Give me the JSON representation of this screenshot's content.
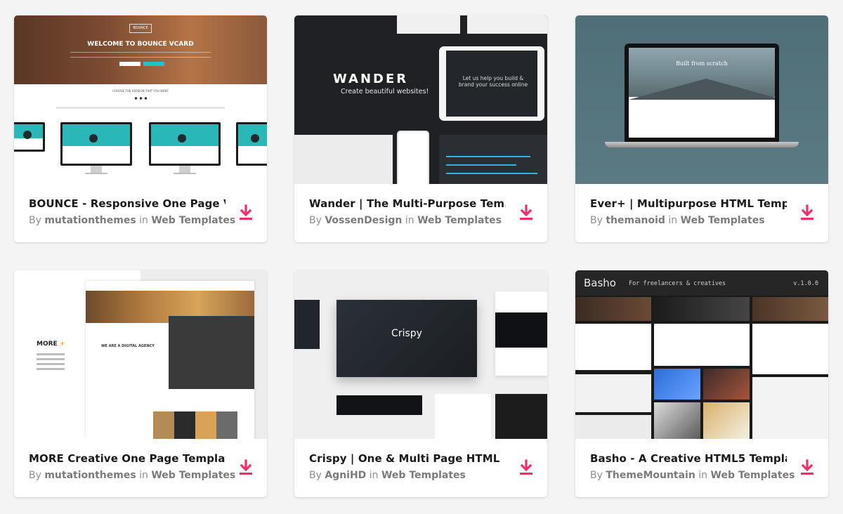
{
  "cards": [
    {
      "title": "BOUNCE - Responsive One Page V...",
      "author": "mutationthemes",
      "category": "Web Templates",
      "thumb": {
        "logo": "BOUNCE",
        "hero_title": "WELCOME TO BOUNCE VCARD",
        "choose": "CHOOSE THE VERSION THAT YOU WANT"
      }
    },
    {
      "title": "Wander | The Multi-Purpose Tem...",
      "author": "VossenDesign",
      "category": "Web Templates",
      "thumb": {
        "brand": "WANDER",
        "tagline": "Create beautiful websites!",
        "tablet_text": "Let us help you build & brand your success online"
      }
    },
    {
      "title": "Ever+ | Multipurpose HTML Temp...",
      "author": "themanoid",
      "category": "Web Templates",
      "thumb": {
        "headline": "Built from scratch"
      }
    },
    {
      "title": "MORE Creative One Page Template",
      "author": "mutationthemes",
      "category": "Web Templates",
      "thumb": {
        "brand": "MORE",
        "plus": "+",
        "agency": "WE ARE A DIGITAL AGENCY"
      }
    },
    {
      "title": "Crispy | One & Multi Page HTML",
      "author": "AgniHD",
      "category": "Web Templates",
      "thumb": {
        "brand": "Crispy"
      }
    },
    {
      "title": "Basho - A Creative HTML5 Templa...",
      "author": "ThemeMountain",
      "category": "Web Templates",
      "thumb": {
        "brand": "Basho",
        "tagline": "For freelancers & creatives",
        "version": "v.1.0.0"
      }
    }
  ],
  "by_label": "By",
  "in_label": "in",
  "colors": {
    "accent": "#ef2f6a",
    "title": "#1a1a1a",
    "meta": "#8f8f8f"
  },
  "icons": {
    "download": "download-icon"
  }
}
